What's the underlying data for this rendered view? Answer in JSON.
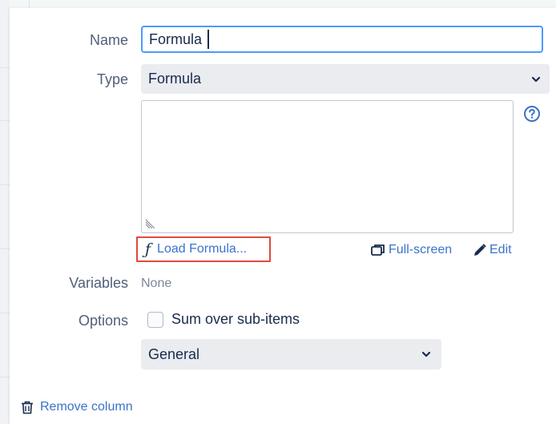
{
  "form": {
    "name_label": "Name",
    "name_value": "Formula",
    "type_label": "Type",
    "type_value": "Formula",
    "variables_label": "Variables",
    "variables_value": "None",
    "options_label": "Options",
    "sum_over_subitems_label": "Sum over sub-items",
    "sum_over_subitems_checked": false,
    "format_value": "General"
  },
  "actions": {
    "load_formula_label": "Load Formula...",
    "fullscreen_label": "Full-screen",
    "edit_label": "Edit",
    "remove_column_label": "Remove column"
  },
  "icons": {
    "load_formula": "function-f-icon",
    "fullscreen": "window-restore-icon",
    "edit": "pencil-icon",
    "help": "question-circle-icon",
    "remove": "trash-icon",
    "dropdown": "chevron-down-icon",
    "resize": "resize-grip-icon"
  },
  "colors": {
    "focus_border": "#4c9aff",
    "link": "#3b73c9",
    "highlight_box": "#e04a3f",
    "select_bg": "#ebecf0"
  }
}
